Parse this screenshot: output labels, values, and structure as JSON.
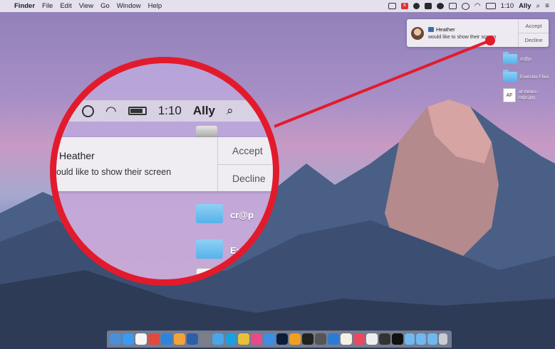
{
  "menubar": {
    "app_name": "Finder",
    "menus": [
      "File",
      "Edit",
      "View",
      "Go",
      "Window",
      "Help"
    ],
    "calendar_day": "6",
    "time": "1:10",
    "user": "Ally"
  },
  "notification": {
    "sender": "Heather",
    "message": "would like to show their screen",
    "accept_label": "Accept",
    "decline_label": "Decline"
  },
  "desktop_icons": [
    {
      "label": "cr@p"
    },
    {
      "label": "Exercise Files"
    },
    {
      "label": "af-mines-logo.jpg",
      "badge": "AF"
    }
  ],
  "zoom": {
    "time": "1:10",
    "user": "Ally",
    "sender": "Heather",
    "message": "ould like to show their screen",
    "accept_label": "Accept",
    "decline_label": "Decline",
    "folder1": "cr@p",
    "folder2": "Exerci"
  },
  "colors": {
    "highlight_ring": "#e21b2c",
    "folder": "#56b2ea"
  }
}
